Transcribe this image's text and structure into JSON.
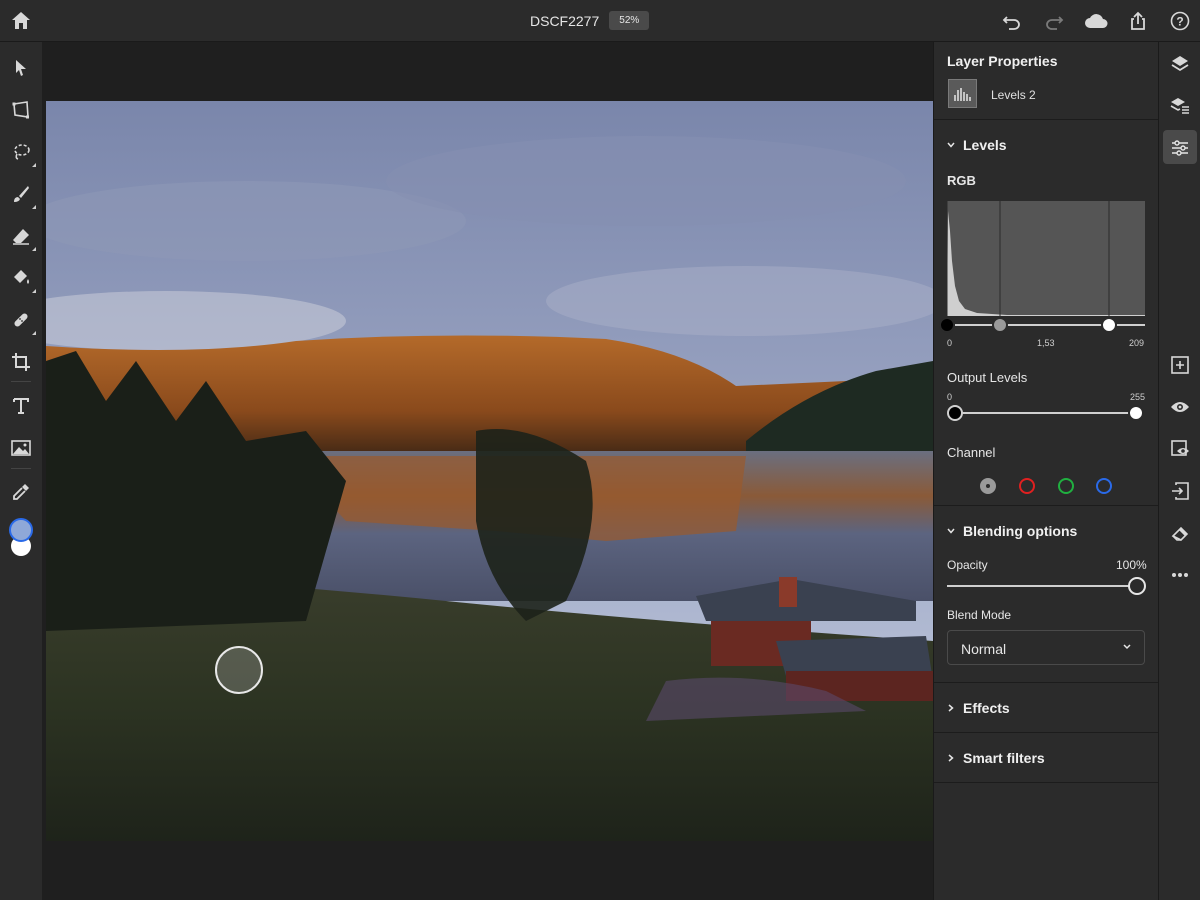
{
  "topbar": {
    "doc_name": "DSCF2277",
    "zoom": "52%"
  },
  "left_tools": [
    "move-tool",
    "transform-tool",
    "lasso-tool",
    "brush-tool",
    "eraser-tool",
    "fill-tool",
    "healing-tool",
    "crop-tool",
    "type-tool",
    "image-tool",
    "eyedropper-tool",
    "color-swatch"
  ],
  "colors": {
    "foreground": "#8fa8d8",
    "background": "#ffffff",
    "accent_red": "#e02020",
    "accent_green": "#20b040",
    "accent_blue": "#2a6ae8"
  },
  "panel": {
    "title": "Layer Properties",
    "layer_name": "Levels 2",
    "levels": {
      "section": "Levels",
      "channel_label": "RGB",
      "input_black": "0",
      "input_mid": "1,53",
      "input_white": "209",
      "input_black_value": 0,
      "input_mid_value": 1.53,
      "input_white_value": 209,
      "output_label": "Output Levels",
      "output_black": "0",
      "output_white": "255",
      "output_black_value": 0,
      "output_white_value": 255,
      "channel_title": "Channel"
    },
    "blending": {
      "section": "Blending options",
      "opacity_label": "Opacity",
      "opacity_value": "100%",
      "blend_mode_label": "Blend Mode",
      "blend_mode_value": "Normal"
    },
    "effects": "Effects",
    "smart_filters": "Smart filters"
  }
}
